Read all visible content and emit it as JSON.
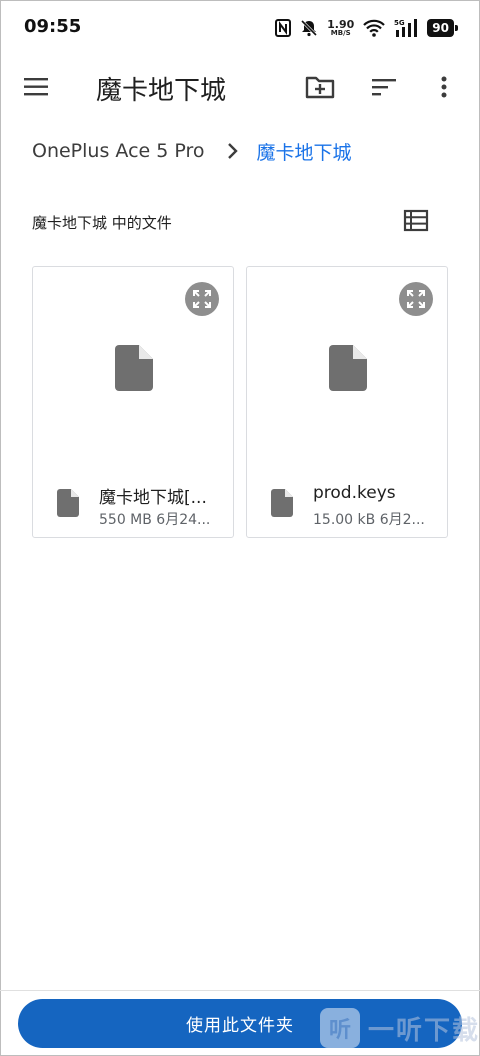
{
  "status_bar": {
    "time": "09:55",
    "net_speed_value": "1.90",
    "net_speed_unit": "MB/S",
    "network_type": "5G",
    "battery": "90"
  },
  "app_bar": {
    "title": "魔卡地下城",
    "icons": [
      "menu-icon",
      "new-folder-icon",
      "sort-icon",
      "more-vert-icon"
    ]
  },
  "breadcrumb": {
    "root": "OnePlus Ace 5 Pro",
    "current": "魔卡地下城"
  },
  "section": {
    "title": "魔卡地下城 中的文件"
  },
  "files": [
    {
      "name": "魔卡地下城[...",
      "details": "550 MB 6月24..."
    },
    {
      "name": "prod.keys",
      "details": "15.00 kB 6月2..."
    }
  ],
  "footer": {
    "button_label": "使用此文件夹"
  },
  "watermark": {
    "mark": "听",
    "text": "一听下载"
  },
  "colors": {
    "accent": "#1a73e8",
    "button": "#1565c0",
    "icon_gray": "#6f6f6f"
  }
}
